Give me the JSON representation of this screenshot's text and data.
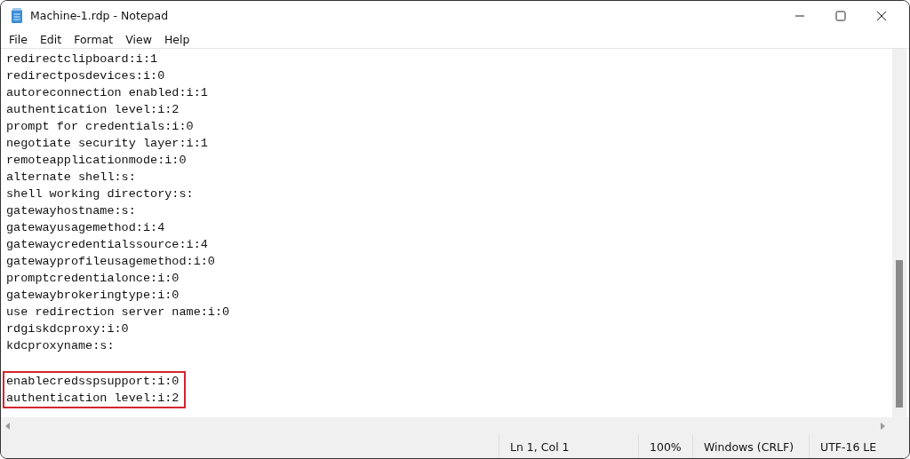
{
  "window": {
    "title": "Machine-1.rdp - Notepad"
  },
  "menu": [
    "File",
    "Edit",
    "Format",
    "View",
    "Help"
  ],
  "lines": [
    "redirectclipboard:i:1",
    "redirectposdevices:i:0",
    "autoreconnection enabled:i:1",
    "authentication level:i:2",
    "prompt for credentials:i:0",
    "negotiate security layer:i:1",
    "remoteapplicationmode:i:0",
    "alternate shell:s:",
    "shell working directory:s:",
    "gatewayhostname:s:",
    "gatewayusagemethod:i:4",
    "gatewaycredentialssource:i:4",
    "gatewayprofileusagemethod:i:0",
    "promptcredentialonce:i:0",
    "gatewaybrokeringtype:i:0",
    "use redirection server name:i:0",
    "rdgiskdcproxy:i:0",
    "kdcproxyname:s:"
  ],
  "highlighted_lines": [
    "enablecredsspsupport:i:0",
    "authentication level:i:2"
  ],
  "status_bar": [
    "Ln 1, Col 1",
    "100%",
    "Windows (CRLF)",
    "UTF-16 LE"
  ]
}
